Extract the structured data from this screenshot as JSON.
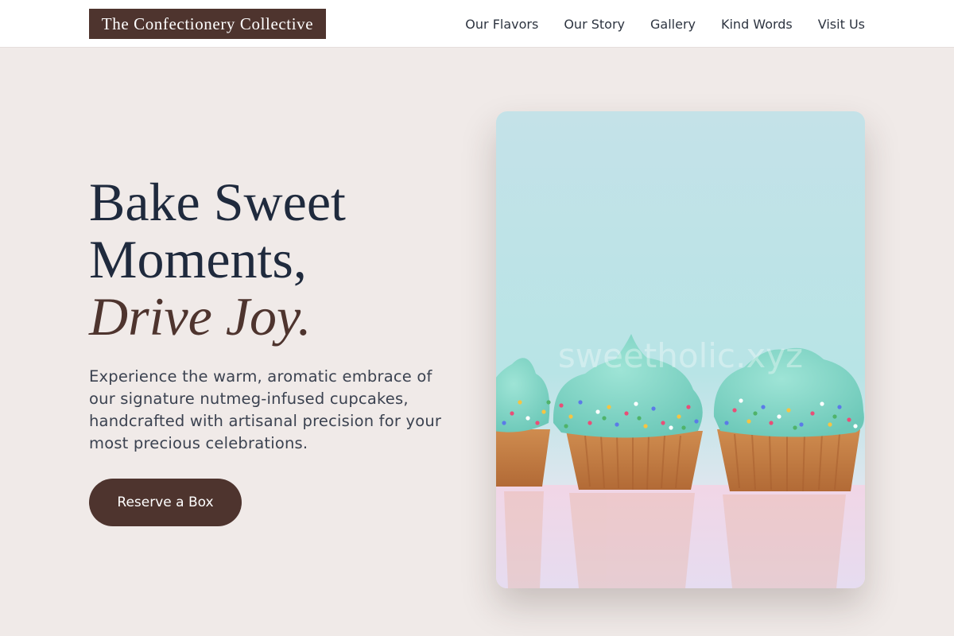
{
  "brand": {
    "name": "The Confectionery Collective"
  },
  "nav": {
    "links": [
      {
        "label": "Our Flavors"
      },
      {
        "label": "Our Story"
      },
      {
        "label": "Gallery"
      },
      {
        "label": "Kind Words"
      },
      {
        "label": "Visit Us"
      }
    ]
  },
  "hero": {
    "headline_line1": "Bake Sweet",
    "headline_line2": "Moments,",
    "headline_accent": "Drive Joy.",
    "description": "Experience the warm, aromatic embrace of our signature nutmeg-infused cupcakes, handcrafted with artisanal precision for your most precious celebrations.",
    "cta_label": "Reserve a Box"
  },
  "image": {
    "subject": "cupcakes-photo",
    "watermark": "sweetholic.xyz"
  },
  "colors": {
    "brand_brown": "#4e342e",
    "page_background": "#f0eae8",
    "headline": "#1f2a3d",
    "frosting": "#7ed6c6",
    "sky": "#bfe6ea"
  }
}
